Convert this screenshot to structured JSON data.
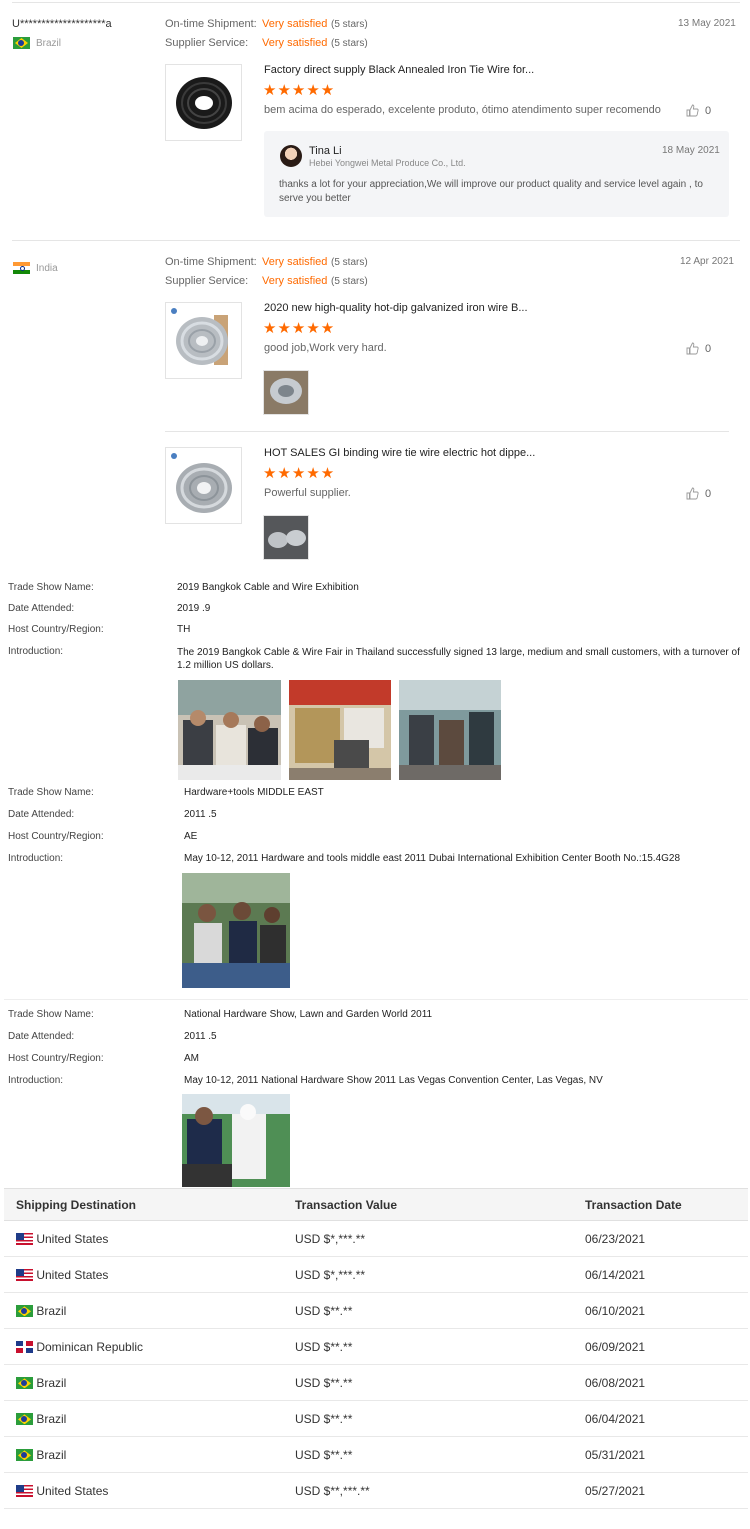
{
  "reviews": [
    {
      "user": "U********************a",
      "country": "Brazil",
      "flag": "br",
      "shipment_label": "On-time Shipment:",
      "shipment_value": "Very satisfied",
      "shipment_stars": "(5 stars)",
      "service_label": "Supplier Service:",
      "service_value": "Very satisfied",
      "service_stars": "(5 stars)",
      "date": "13 May 2021",
      "items": [
        {
          "title": "Factory direct supply Black Annealed Iron Tie Wire for...",
          "rating": 5,
          "text": "bem acima do esperado, excelente produto, ótimo atendimento super recomendo",
          "likes": "0"
        }
      ],
      "reply": {
        "name": "Tina Li",
        "company": "Hebei Yongwei Metal Produce Co., Ltd.",
        "date": "18 May 2021",
        "text": "thanks a lot for your appreciation,We will improve our product quality and service level again , to serve you better"
      }
    },
    {
      "user": "",
      "country": "India",
      "flag": "in",
      "shipment_label": "On-time Shipment:",
      "shipment_value": "Very satisfied",
      "shipment_stars": "(5 stars)",
      "service_label": "Supplier Service:",
      "service_value": "Very satisfied",
      "service_stars": "(5 stars)",
      "date": "12 Apr 2021",
      "items": [
        {
          "title": "2020 new high-quality hot-dip galvanized iron wire B...",
          "rating": 5,
          "text": "good job,Work very hard.",
          "likes": "0"
        },
        {
          "title": "HOT SALES GI binding wire tie wire electric hot dippe...",
          "rating": 5,
          "text": "Powerful supplier.",
          "likes": "0"
        }
      ]
    }
  ],
  "trade_show_labels": {
    "name": "Trade Show Name:",
    "date": "Date Attended:",
    "host": "Host Country/Region:",
    "intro": "Introduction:"
  },
  "trade_shows": [
    {
      "name": "2019 Bangkok Cable and Wire Exhibition",
      "date": "2019 .9",
      "host": "TH",
      "intro": "The 2019 Bangkok Cable & Wire Fair in Thailand successfully signed 13 large, medium and small customers, with a turnover of 1.2 million US dollars."
    },
    {
      "name": "Hardware+tools MIDDLE EAST",
      "date": "2011 .5",
      "host": "AE",
      "intro": "May 10-12, 2011 Hardware and tools middle east 2011 Dubai International Exhibition Center Booth No.:15.4G28"
    },
    {
      "name": "National Hardware Show, Lawn and Garden World 2011",
      "date": "2011 .5",
      "host": "AM",
      "intro": "May 10-12, 2011 National Hardware Show 2011 Las Vegas Convention Center, Las Vegas, NV"
    }
  ],
  "transactions": {
    "headers": [
      "Shipping Destination",
      "Transaction Value",
      "Transaction Date"
    ],
    "rows": [
      {
        "flag": "us",
        "country": "United States",
        "value": "USD $*,***.**",
        "date": "06/23/2021"
      },
      {
        "flag": "us",
        "country": "United States",
        "value": "USD $*,***.**",
        "date": "06/14/2021"
      },
      {
        "flag": "br",
        "country": "Brazil",
        "value": "USD $**.**",
        "date": "06/10/2021"
      },
      {
        "flag": "do",
        "country": "Dominican Republic",
        "value": "USD $**.**",
        "date": "06/09/2021"
      },
      {
        "flag": "br",
        "country": "Brazil",
        "value": "USD $**.**",
        "date": "06/08/2021"
      },
      {
        "flag": "br",
        "country": "Brazil",
        "value": "USD $**.**",
        "date": "06/04/2021"
      },
      {
        "flag": "br",
        "country": "Brazil",
        "value": "USD $**.**",
        "date": "05/31/2021"
      },
      {
        "flag": "us",
        "country": "United States",
        "value": "USD $**,***.**",
        "date": "05/27/2021"
      }
    ]
  },
  "colors": {
    "accent": "#ff6a00",
    "header_bg": "#f5f5f5"
  }
}
